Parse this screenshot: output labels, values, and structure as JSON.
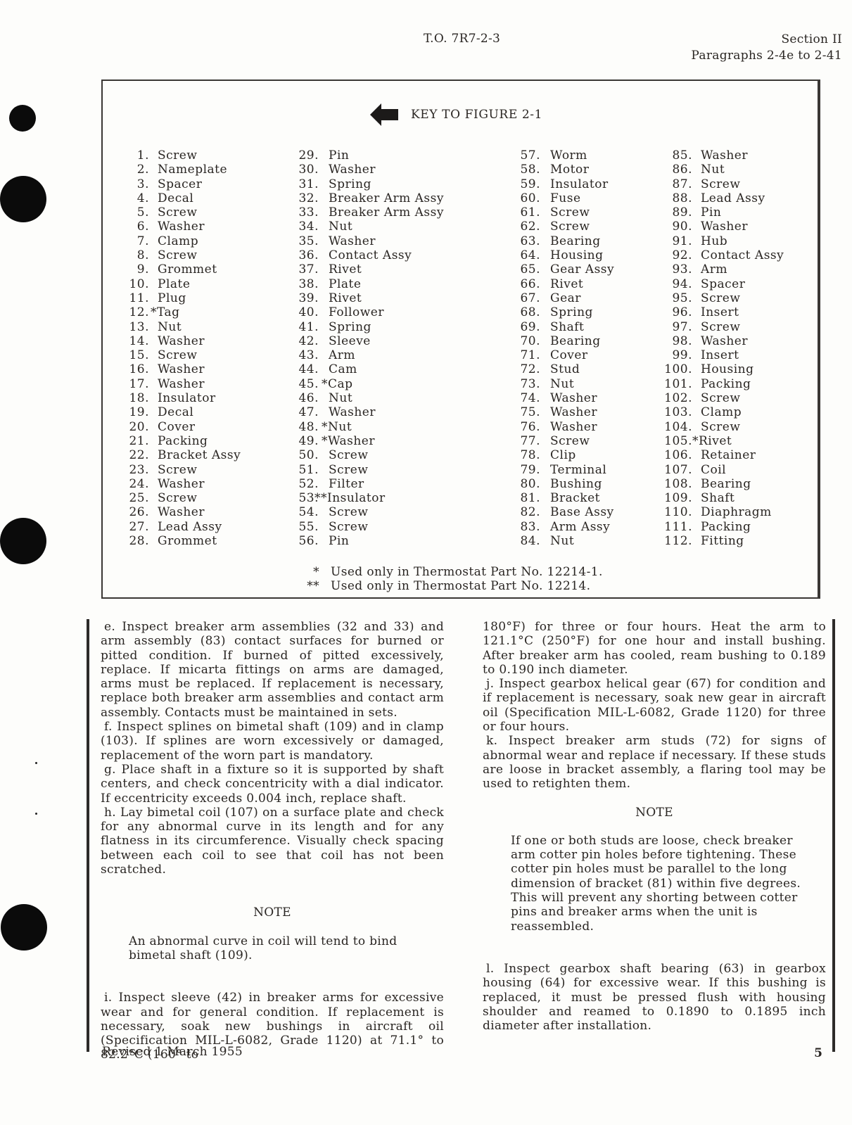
{
  "header": {
    "to_number": "T.O. 7R7-2-3",
    "section": "Section II",
    "paragraphs": "Paragraphs 2-4e to 2-41"
  },
  "key": {
    "title": "KEY TO FIGURE 2-1",
    "columns": [
      [
        {
          "n": "1.",
          "name": "Screw"
        },
        {
          "n": "2.",
          "name": "Nameplate"
        },
        {
          "n": "3.",
          "name": "Spacer"
        },
        {
          "n": "4.",
          "name": "Decal"
        },
        {
          "n": "5.",
          "name": "Screw"
        },
        {
          "n": "6.",
          "name": "Washer"
        },
        {
          "n": "7.",
          "name": "Clamp"
        },
        {
          "n": "8.",
          "name": "Screw"
        },
        {
          "n": "9.",
          "name": "Grommet"
        },
        {
          "n": "10.",
          "name": "Plate"
        },
        {
          "n": "11.",
          "name": "Plug"
        },
        {
          "n": "12.",
          "name": "*Tag"
        },
        {
          "n": "13.",
          "name": "Nut"
        },
        {
          "n": "14.",
          "name": "Washer"
        },
        {
          "n": "15.",
          "name": "Screw"
        },
        {
          "n": "16.",
          "name": "Washer"
        },
        {
          "n": "17.",
          "name": "Washer"
        },
        {
          "n": "18.",
          "name": "Insulator"
        },
        {
          "n": "19.",
          "name": "Decal"
        },
        {
          "n": "20.",
          "name": "Cover"
        },
        {
          "n": "21.",
          "name": "Packing"
        },
        {
          "n": "22.",
          "name": "Bracket Assy"
        },
        {
          "n": "23.",
          "name": "Screw"
        },
        {
          "n": "24.",
          "name": "Washer"
        },
        {
          "n": "25.",
          "name": "Screw"
        },
        {
          "n": "26.",
          "name": "Washer"
        },
        {
          "n": "27.",
          "name": "Lead Assy"
        },
        {
          "n": "28.",
          "name": "Grommet"
        }
      ],
      [
        {
          "n": "29.",
          "name": "Pin"
        },
        {
          "n": "30.",
          "name": "Washer"
        },
        {
          "n": "31.",
          "name": "Spring"
        },
        {
          "n": "32.",
          "name": "Breaker Arm Assy"
        },
        {
          "n": "33.",
          "name": "Breaker Arm Assy"
        },
        {
          "n": "34.",
          "name": "Nut"
        },
        {
          "n": "35.",
          "name": "Washer"
        },
        {
          "n": "36.",
          "name": "Contact Assy"
        },
        {
          "n": "37.",
          "name": "Rivet"
        },
        {
          "n": "38.",
          "name": "Plate"
        },
        {
          "n": "39.",
          "name": "Rivet"
        },
        {
          "n": "40.",
          "name": "Follower"
        },
        {
          "n": "41.",
          "name": "Spring"
        },
        {
          "n": "42.",
          "name": "Sleeve"
        },
        {
          "n": "43.",
          "name": "Arm"
        },
        {
          "n": "44.",
          "name": "Cam"
        },
        {
          "n": "45.",
          "name": "*Cap"
        },
        {
          "n": "46.",
          "name": "Nut"
        },
        {
          "n": "47.",
          "name": "Washer"
        },
        {
          "n": "48.",
          "name": "*Nut"
        },
        {
          "n": "49.",
          "name": "*Washer"
        },
        {
          "n": "50.",
          "name": "Screw"
        },
        {
          "n": "51.",
          "name": "Screw"
        },
        {
          "n": "52.",
          "name": "Filter"
        },
        {
          "n": "53.",
          "name": "**Insulator"
        },
        {
          "n": "54.",
          "name": "Screw"
        },
        {
          "n": "55.",
          "name": "Screw"
        },
        {
          "n": "56.",
          "name": "Pin"
        }
      ],
      [
        {
          "n": "57.",
          "name": "Worm"
        },
        {
          "n": "58.",
          "name": "Motor"
        },
        {
          "n": "59.",
          "name": "Insulator"
        },
        {
          "n": "60.",
          "name": "Fuse"
        },
        {
          "n": "61.",
          "name": "Screw"
        },
        {
          "n": "62.",
          "name": "Screw"
        },
        {
          "n": "63.",
          "name": "Bearing"
        },
        {
          "n": "64.",
          "name": "Housing"
        },
        {
          "n": "65.",
          "name": "Gear Assy"
        },
        {
          "n": "66.",
          "name": "Rivet"
        },
        {
          "n": "67.",
          "name": "Gear"
        },
        {
          "n": "68.",
          "name": "Spring"
        },
        {
          "n": "69.",
          "name": "Shaft"
        },
        {
          "n": "70.",
          "name": "Bearing"
        },
        {
          "n": "71.",
          "name": "Cover"
        },
        {
          "n": "72.",
          "name": "Stud"
        },
        {
          "n": "73.",
          "name": "Nut"
        },
        {
          "n": "74.",
          "name": "Washer"
        },
        {
          "n": "75.",
          "name": "Washer"
        },
        {
          "n": "76.",
          "name": "Washer"
        },
        {
          "n": "77.",
          "name": "Screw"
        },
        {
          "n": "78.",
          "name": "Clip"
        },
        {
          "n": "79.",
          "name": "Terminal"
        },
        {
          "n": "80.",
          "name": "Bushing"
        },
        {
          "n": "81.",
          "name": "Bracket"
        },
        {
          "n": "82.",
          "name": "Base Assy"
        },
        {
          "n": "83.",
          "name": "Arm Assy"
        },
        {
          "n": "84.",
          "name": "Nut"
        }
      ],
      [
        {
          "n": "85.",
          "name": "Washer"
        },
        {
          "n": "86.",
          "name": "Nut"
        },
        {
          "n": "87.",
          "name": "Screw"
        },
        {
          "n": "88.",
          "name": "Lead Assy"
        },
        {
          "n": "89.",
          "name": "Pin"
        },
        {
          "n": "90.",
          "name": "Washer"
        },
        {
          "n": "91.",
          "name": "Hub"
        },
        {
          "n": "92.",
          "name": "Contact Assy"
        },
        {
          "n": "93.",
          "name": "Arm"
        },
        {
          "n": "94.",
          "name": "Spacer"
        },
        {
          "n": "95.",
          "name": "Screw"
        },
        {
          "n": "96.",
          "name": "Insert"
        },
        {
          "n": "97.",
          "name": "Screw"
        },
        {
          "n": "98.",
          "name": "Washer"
        },
        {
          "n": "99.",
          "name": "Insert"
        },
        {
          "n": "100.",
          "name": "Housing"
        },
        {
          "n": "101.",
          "name": "Packing"
        },
        {
          "n": "102.",
          "name": "Screw"
        },
        {
          "n": "103.",
          "name": "Clamp"
        },
        {
          "n": "104.",
          "name": "Screw"
        },
        {
          "n": "105.",
          "name": "*Rivet"
        },
        {
          "n": "106.",
          "name": "Retainer"
        },
        {
          "n": "107.",
          "name": "Coil"
        },
        {
          "n": "108.",
          "name": "Bearing"
        },
        {
          "n": "109.",
          "name": "Shaft"
        },
        {
          "n": "110.",
          "name": "Diaphragm"
        },
        {
          "n": "111.",
          "name": "Packing"
        },
        {
          "n": "112.",
          "name": "Fitting"
        }
      ]
    ],
    "footnotes": [
      {
        "mark": "*",
        "text": "Used only in Thermostat Part No. 12214-1."
      },
      {
        "mark": "**",
        "text": "Used only in Thermostat Part No. 12214."
      }
    ]
  },
  "body": {
    "left": {
      "para_e": "e. Inspect breaker arm assemblies (32 and 33) and arm assembly (83) contact surfaces for burned or pitted condition. If burned of pitted excessively, replace. If micarta fittings on arms are damaged, arms must be replaced. If replacement is necessary, replace both breaker arm assemblies and contact arm assembly. Contacts must be maintained in sets.",
      "para_f": "f. Inspect splines on bimetal shaft (109) and in clamp (103). If splines are worn excessively or damaged, replacement of the worn part is mandatory.",
      "para_g": "g. Place shaft in a fixture so it is supported by shaft centers, and check concentricity with a dial indicator. If eccentricity exceeds 0.004 inch, replace shaft.",
      "para_h": "h. Lay bimetal coil (107) on a surface plate and check for any abnormal curve in its length and for any flatness in its circumference. Visually check spacing between each coil to see that coil has not been scratched.",
      "note_title": "NOTE",
      "note_text": "An abnormal curve in coil will tend to bind bimetal shaft (109).",
      "para_i": "i. Inspect sleeve (42) in breaker arms for excessive wear and for general condition. If replacement is necessary, soak new bushings in aircraft oil (Specification MIL-L-6082, Grade 1120) at 71.1° to 82.2°C (160° to"
    },
    "right": {
      "para_i_cont": "180°F) for three or four hours. Heat the arm to 121.1°C (250°F) for one hour and install bushing. After breaker arm has cooled, ream bushing to 0.189 to 0.190 inch diameter.",
      "para_j": "j. Inspect gearbox helical gear (67) for condition and if replacement is necessary, soak new gear in aircraft oil (Specification MIL-L-6082, Grade 1120) for three or four hours.",
      "para_k": "k. Inspect breaker arm studs (72) for signs of abnormal wear and replace if necessary. If these studs are loose in bracket assembly, a flaring tool may be used to retighten them.",
      "note_title": "NOTE",
      "note_text": "If one or both studs are loose, check breaker arm cotter pin holes before tightening. These cotter pin holes must be parallel to the long dimension of bracket (81) within five degrees. This will prevent any shorting between cotter pins and breaker arms when the unit is reassembled.",
      "para_l": "l. Inspect gearbox shaft bearing (63) in gearbox housing (64) for excessive wear. If this bushing is replaced, it must be pressed flush with housing shoulder and reamed to 0.1890 to 0.1895 inch diameter after installation."
    }
  },
  "footer": {
    "revised": "Revised 1 March 1955",
    "page_number": "5"
  }
}
